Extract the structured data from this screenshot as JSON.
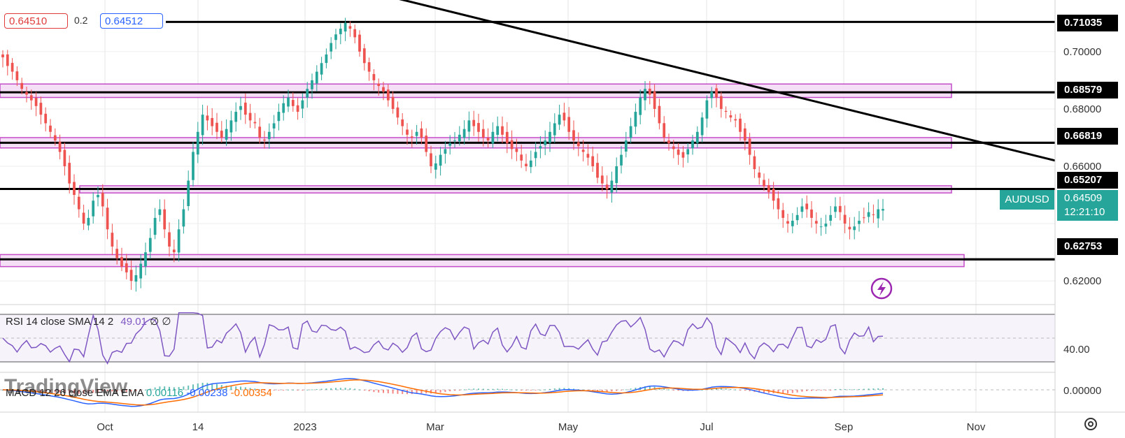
{
  "quote": {
    "sell": "0.64510",
    "spread": "0.2",
    "buy": "0.64512"
  },
  "symbol": "AUDUSD",
  "current": {
    "price": "0.64509",
    "countdown": "12:21:10"
  },
  "colors": {
    "up": "#26a69a",
    "down": "#ef5350",
    "zone_fill": "#f3d9f5",
    "zone_border": "#c44cc8",
    "rsi": "#7e57c2",
    "macd": "#2962ff",
    "signal": "#ff6d00"
  },
  "rsi_legend": {
    "label": "RSI 14 close SMA 14 2",
    "value": "49.01",
    "na1": "∅",
    "na2": "∅"
  },
  "macd_legend": {
    "label": "MACD 12 26 close EMA EMA",
    "hist": "0.00116",
    "macd": "-0.00238",
    "signal": "-0.00354"
  },
  "watermark": "TradingView",
  "chart_data": {
    "type": "candlestick",
    "symbol": "AUDUSD",
    "yaxis": {
      "ticks": [
        "0.70000",
        "0.68000",
        "0.66000",
        "0.62000"
      ],
      "range": [
        0.612,
        0.718
      ]
    },
    "xaxis": {
      "ticks": [
        "Oct",
        "14",
        "2023",
        "Mar",
        "May",
        "Jul",
        "Sep",
        "Nov"
      ]
    },
    "levels": [
      "0.71035",
      "0.68579",
      "0.66819",
      "0.65207",
      "0.62753"
    ],
    "zones": [
      {
        "low": 0.684,
        "high": 0.6887
      },
      {
        "low": 0.6664,
        "high": 0.67
      },
      {
        "low": 0.6507,
        "high": 0.6532
      },
      {
        "low": 0.625,
        "high": 0.6292
      }
    ],
    "trendline": {
      "from": {
        "date": "2022-08-10",
        "price": 0.725
      },
      "to": {
        "date": "2023-10-20",
        "price": 0.662
      }
    },
    "closes": [
      0.698,
      0.695,
      0.693,
      0.69,
      0.687,
      0.685,
      0.683,
      0.681,
      0.678,
      0.675,
      0.672,
      0.669,
      0.665,
      0.66,
      0.654,
      0.65,
      0.645,
      0.64,
      0.642,
      0.648,
      0.65,
      0.646,
      0.638,
      0.632,
      0.628,
      0.625,
      0.623,
      0.62,
      0.622,
      0.626,
      0.63,
      0.635,
      0.642,
      0.645,
      0.638,
      0.632,
      0.63,
      0.638,
      0.645,
      0.655,
      0.665,
      0.672,
      0.678,
      0.676,
      0.674,
      0.672,
      0.67,
      0.673,
      0.676,
      0.679,
      0.681,
      0.678,
      0.676,
      0.675,
      0.67,
      0.669,
      0.672,
      0.675,
      0.679,
      0.682,
      0.684,
      0.681,
      0.679,
      0.683,
      0.687,
      0.69,
      0.693,
      0.696,
      0.699,
      0.703,
      0.706,
      0.708,
      0.71,
      0.708,
      0.705,
      0.7,
      0.696,
      0.693,
      0.69,
      0.688,
      0.686,
      0.683,
      0.68,
      0.677,
      0.674,
      0.671,
      0.67,
      0.672,
      0.67,
      0.665,
      0.66,
      0.661,
      0.664,
      0.666,
      0.668,
      0.669,
      0.671,
      0.673,
      0.676,
      0.674,
      0.672,
      0.67,
      0.669,
      0.672,
      0.674,
      0.671,
      0.668,
      0.666,
      0.665,
      0.662,
      0.66,
      0.662,
      0.665,
      0.667,
      0.669,
      0.672,
      0.675,
      0.678,
      0.676,
      0.672,
      0.669,
      0.667,
      0.665,
      0.663,
      0.66,
      0.656,
      0.654,
      0.652,
      0.655,
      0.66,
      0.664,
      0.669,
      0.674,
      0.679,
      0.684,
      0.687,
      0.685,
      0.68,
      0.675,
      0.67,
      0.668,
      0.666,
      0.664,
      0.663,
      0.666,
      0.669,
      0.672,
      0.677,
      0.683,
      0.686,
      0.684,
      0.68,
      0.679,
      0.677,
      0.676,
      0.672,
      0.669,
      0.664,
      0.659,
      0.656,
      0.653,
      0.651,
      0.648,
      0.645,
      0.642,
      0.64,
      0.641,
      0.643,
      0.646,
      0.645,
      0.642,
      0.64,
      0.639,
      0.64,
      0.643,
      0.646,
      0.644,
      0.64,
      0.638,
      0.639,
      0.641,
      0.642,
      0.644,
      0.643,
      0.645,
      0.6451
    ]
  }
}
